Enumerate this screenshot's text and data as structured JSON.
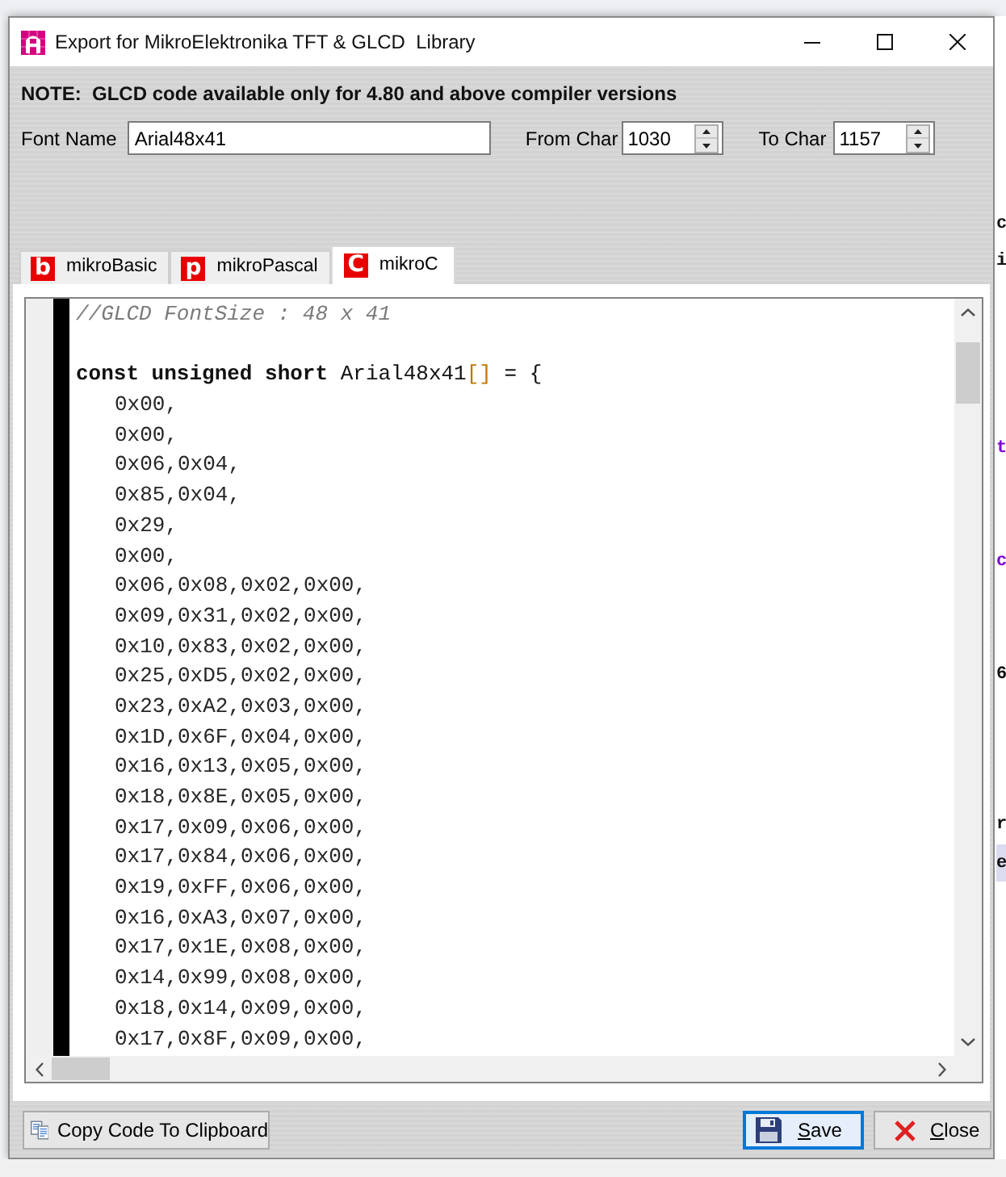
{
  "window": {
    "title": "Export for MikroElektronika TFT & GLCD  Library"
  },
  "note": "NOTE:  GLCD code available only for 4.80 and above compiler versions",
  "font_name": {
    "label": "Font Name",
    "value": "Arial48x41"
  },
  "from_char": {
    "label": "From Char",
    "value": "1030"
  },
  "to_char": {
    "label": "To Char",
    "value": "1157"
  },
  "tabs": [
    {
      "letter": "b",
      "label": "mikroBasic",
      "selected": false
    },
    {
      "letter": "p",
      "label": "mikroPascal",
      "selected": false
    },
    {
      "letter": "C",
      "label": "mikroC",
      "selected": true
    }
  ],
  "code": {
    "lines": [
      {
        "kind": "comment",
        "text": "//GLCD FontSize : 48 x 41"
      },
      {
        "kind": "blank"
      },
      {
        "kind": "declaration",
        "keywords": "const unsigned short",
        "name": "Arial48x41",
        "brackets": "[]",
        "rest": "= {"
      },
      {
        "kind": "data",
        "text": "0x00,"
      },
      {
        "kind": "data",
        "text": "0x00,"
      },
      {
        "kind": "data",
        "text": "0x06,0x04,"
      },
      {
        "kind": "data",
        "text": "0x85,0x04,"
      },
      {
        "kind": "data",
        "text": "0x29,"
      },
      {
        "kind": "data",
        "text": "0x00,"
      },
      {
        "kind": "data",
        "text": "0x06,0x08,0x02,0x00,"
      },
      {
        "kind": "data",
        "text": "0x09,0x31,0x02,0x00,"
      },
      {
        "kind": "data",
        "text": "0x10,0x83,0x02,0x00,"
      },
      {
        "kind": "data",
        "text": "0x25,0xD5,0x02,0x00,"
      },
      {
        "kind": "data",
        "text": "0x23,0xA2,0x03,0x00,"
      },
      {
        "kind": "data",
        "text": "0x1D,0x6F,0x04,0x00,"
      },
      {
        "kind": "data",
        "text": "0x16,0x13,0x05,0x00,"
      },
      {
        "kind": "data",
        "text": "0x18,0x8E,0x05,0x00,"
      },
      {
        "kind": "data",
        "text": "0x17,0x09,0x06,0x00,"
      },
      {
        "kind": "data",
        "text": "0x17,0x84,0x06,0x00,"
      },
      {
        "kind": "data",
        "text": "0x19,0xFF,0x06,0x00,"
      },
      {
        "kind": "data",
        "text": "0x16,0xA3,0x07,0x00,"
      },
      {
        "kind": "data",
        "text": "0x17,0x1E,0x08,0x00,"
      },
      {
        "kind": "data",
        "text": "0x14,0x99,0x08,0x00,"
      },
      {
        "kind": "data",
        "text": "0x18,0x14,0x09,0x00,"
      },
      {
        "kind": "data",
        "text": "0x17,0x8F,0x09,0x00,"
      }
    ]
  },
  "buttons": [
    {
      "kind": "copy",
      "label": "Copy Code To Clipboard",
      "mnemonic": false,
      "focused": false
    },
    {
      "kind": "save",
      "label": "Save",
      "mnemonic": true,
      "focused": true
    },
    {
      "kind": "close",
      "label": "Close",
      "mnemonic": true,
      "focused": false
    }
  ],
  "background_editor": {
    "lines": [
      {
        "kind": "plain",
        "text": "c",
        "highlighted": false
      },
      {
        "kind": "plain",
        "text": "i",
        "highlighted": false
      },
      {
        "kind": "blank"
      },
      {
        "kind": "blank"
      },
      {
        "kind": "blank"
      },
      {
        "kind": "blank"
      },
      {
        "kind": "keyword",
        "text": "t",
        "highlighted": false
      },
      {
        "kind": "blank"
      },
      {
        "kind": "blank"
      },
      {
        "kind": "keyword",
        "text": "c",
        "highlighted": false
      },
      {
        "kind": "blank"
      },
      {
        "kind": "blank"
      },
      {
        "kind": "plain",
        "text": "6",
        "highlighted": false
      },
      {
        "kind": "blank"
      },
      {
        "kind": "blank"
      },
      {
        "kind": "blank"
      },
      {
        "kind": "plain",
        "text": "r",
        "highlighted": false
      },
      {
        "kind": "plain",
        "text": "e",
        "highlighted": true
      }
    ]
  }
}
